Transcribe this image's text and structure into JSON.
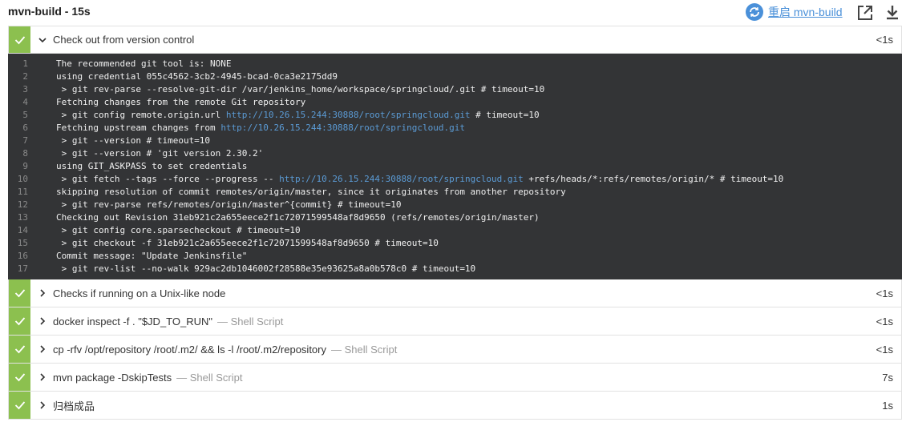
{
  "header": {
    "title": "mvn-build - 15s",
    "restart_label": "重启 mvn-build"
  },
  "colors": {
    "success": "#8cc04f",
    "link": "#4a90d9",
    "log_bg": "#333436"
  },
  "steps": [
    {
      "title": "Check out from version control",
      "sub": "",
      "duration": "<1s",
      "expanded": true,
      "status": "success"
    },
    {
      "title": "Checks if running on a Unix-like node",
      "sub": "",
      "duration": "<1s",
      "expanded": false,
      "status": "success"
    },
    {
      "title": "docker inspect -f . \"$JD_TO_RUN\"",
      "sub": "— Shell Script",
      "duration": "<1s",
      "expanded": false,
      "status": "success"
    },
    {
      "title": "cp -rfv /opt/repository /root/.m2/ && ls -l /root/.m2/repository",
      "sub": "— Shell Script",
      "duration": "<1s",
      "expanded": false,
      "status": "success"
    },
    {
      "title": "mvn package -DskipTests",
      "sub": "— Shell Script",
      "duration": "7s",
      "expanded": false,
      "status": "success"
    },
    {
      "title": "归档成品",
      "sub": "",
      "duration": "1s",
      "expanded": false,
      "status": "success"
    }
  ],
  "log": [
    {
      "n": "1",
      "pre": "The recommended git tool is: NONE",
      "url": "",
      "post": ""
    },
    {
      "n": "2",
      "pre": "using credential 055c4562-3cb2-4945-bcad-0ca3e2175dd9",
      "url": "",
      "post": ""
    },
    {
      "n": "3",
      "pre": " > git rev-parse --resolve-git-dir /var/jenkins_home/workspace/springcloud/.git # timeout=10",
      "url": "",
      "post": ""
    },
    {
      "n": "4",
      "pre": "Fetching changes from the remote Git repository",
      "url": "",
      "post": ""
    },
    {
      "n": "5",
      "pre": " > git config remote.origin.url ",
      "url": "http://10.26.15.244:30888/root/springcloud.git",
      "post": " # timeout=10"
    },
    {
      "n": "6",
      "pre": "Fetching upstream changes from ",
      "url": "http://10.26.15.244:30888/root/springcloud.git",
      "post": ""
    },
    {
      "n": "7",
      "pre": " > git --version # timeout=10",
      "url": "",
      "post": ""
    },
    {
      "n": "8",
      "pre": " > git --version # 'git version 2.30.2'",
      "url": "",
      "post": ""
    },
    {
      "n": "9",
      "pre": "using GIT_ASKPASS to set credentials",
      "url": "",
      "post": ""
    },
    {
      "n": "10",
      "pre": " > git fetch --tags --force --progress -- ",
      "url": "http://10.26.15.244:30888/root/springcloud.git",
      "post": " +refs/heads/*:refs/remotes/origin/* # timeout=10"
    },
    {
      "n": "11",
      "pre": "skipping resolution of commit remotes/origin/master, since it originates from another repository",
      "url": "",
      "post": ""
    },
    {
      "n": "12",
      "pre": " > git rev-parse refs/remotes/origin/master^{commit} # timeout=10",
      "url": "",
      "post": ""
    },
    {
      "n": "13",
      "pre": "Checking out Revision 31eb921c2a655eece2f1c72071599548af8d9650 (refs/remotes/origin/master)",
      "url": "",
      "post": ""
    },
    {
      "n": "14",
      "pre": " > git config core.sparsecheckout # timeout=10",
      "url": "",
      "post": ""
    },
    {
      "n": "15",
      "pre": " > git checkout -f 31eb921c2a655eece2f1c72071599548af8d9650 # timeout=10",
      "url": "",
      "post": ""
    },
    {
      "n": "16",
      "pre": "Commit message: \"Update Jenkinsfile\"",
      "url": "",
      "post": ""
    },
    {
      "n": "17",
      "pre": " > git rev-list --no-walk 929ac2db1046002f28588e35e93625a8a0b578c0 # timeout=10",
      "url": "",
      "post": ""
    }
  ]
}
